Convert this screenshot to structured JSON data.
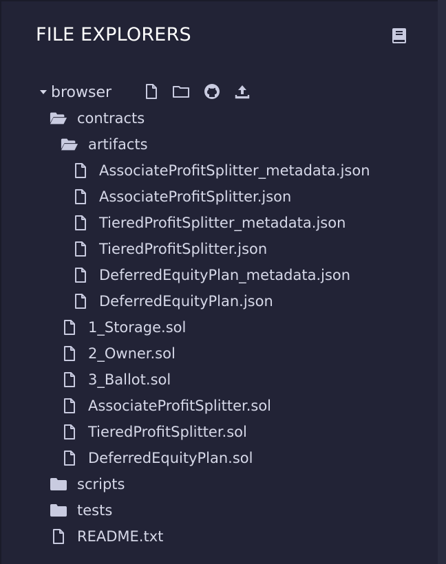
{
  "header": {
    "title": "FILE EXPLORERS",
    "book_icon": "book-icon"
  },
  "root": {
    "label": "browser",
    "toolbar": [
      "new-file-icon",
      "new-folder-icon",
      "github-icon",
      "upload-icon"
    ]
  },
  "tree": [
    {
      "label": "contracts",
      "icon": "folder-open-icon"
    },
    {
      "label": "artifacts",
      "icon": "folder-open-icon"
    },
    {
      "label": "AssociateProfitSplitter_metadata.json",
      "icon": "file-icon"
    },
    {
      "label": "AssociateProfitSplitter.json",
      "icon": "file-icon"
    },
    {
      "label": "TieredProfitSplitter_metadata.json",
      "icon": "file-icon"
    },
    {
      "label": "TieredProfitSplitter.json",
      "icon": "file-icon"
    },
    {
      "label": "DeferredEquityPlan_metadata.json",
      "icon": "file-icon"
    },
    {
      "label": "DeferredEquityPlan.json",
      "icon": "file-icon"
    },
    {
      "label": "1_Storage.sol",
      "icon": "file-icon"
    },
    {
      "label": "2_Owner.sol",
      "icon": "file-icon"
    },
    {
      "label": "3_Ballot.sol",
      "icon": "file-icon"
    },
    {
      "label": "AssociateProfitSplitter.sol",
      "icon": "file-icon"
    },
    {
      "label": "TieredProfitSplitter.sol",
      "icon": "file-icon"
    },
    {
      "label": "DeferredEquityPlan.sol",
      "icon": "file-icon"
    },
    {
      "label": "scripts",
      "icon": "folder-icon"
    },
    {
      "label": "tests",
      "icon": "folder-icon"
    },
    {
      "label": "README.txt",
      "icon": "file-icon"
    }
  ],
  "colors": {
    "panel_bg": "#222336",
    "text": "#d6d8e8",
    "title": "#ffffff",
    "icon": "#c9cbe0"
  }
}
